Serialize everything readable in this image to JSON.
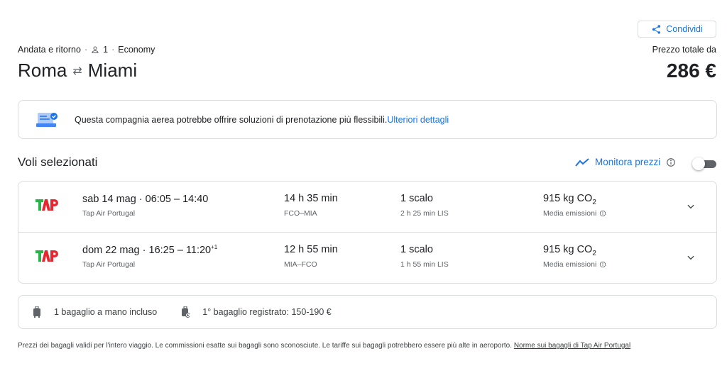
{
  "header": {
    "share_label": "Condividi",
    "trip_type": "Andata e ritorno",
    "passengers": "1",
    "cabin_class": "Economy",
    "origin": "Roma",
    "destination": "Miami",
    "price_label": "Prezzo totale da",
    "price": "286 €"
  },
  "banner": {
    "text": "Questa compagnia aerea potrebbe offrire soluzioni di prenotazione più flessibili. ",
    "link": "Ulteriori dettagli"
  },
  "selected": {
    "title": "Voli selezionati",
    "monitor_label": "Monitora prezzi",
    "monitor_enabled": false
  },
  "flights": [
    {
      "date": "sab 14 mag",
      "times": "06:05 – 14:40",
      "day_offset": "",
      "airline": "Tap Air Portugal",
      "duration": "14 h 35 min",
      "route": "FCO–MIA",
      "stops": "1 scalo",
      "layover": "2 h 25 min LIS",
      "co2_value": "915 kg CO",
      "co2_sub": "2",
      "emissions_label": "Media emissioni"
    },
    {
      "date": "dom 22 mag",
      "times": "16:25 – 11:20",
      "day_offset": "+1",
      "airline": "Tap Air Portugal",
      "duration": "12 h 55 min",
      "route": "MIA–FCO",
      "stops": "1 scalo",
      "layover": "1 h 55 min LIS",
      "co2_value": "915 kg CO",
      "co2_sub": "2",
      "emissions_label": "Media emissioni"
    }
  ],
  "baggage": {
    "carry_on": "1 bagaglio a mano incluso",
    "checked": "1° bagaglio registrato: 150-190 €"
  },
  "footnote": {
    "text": "Prezzi dei bagagli validi per l'intero viaggio. Le commissioni esatte sui bagagli sono sconosciute. Le tariffe sui bagagli potrebbero essere più alte in aeroporto. ",
    "link": "Norme sui bagagli di Tap Air Portugal"
  },
  "colors": {
    "accent": "#1a73e8",
    "tap_green": "#2bb24c",
    "tap_red": "#e8262f",
    "toggle_off": "#5f6368"
  }
}
